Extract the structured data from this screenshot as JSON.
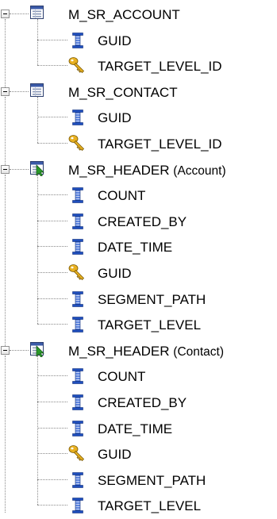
{
  "tree": {
    "nodes": [
      {
        "label": "M_SR_ACCOUNT",
        "suffix": "",
        "icon": "table-icon",
        "expanded": true,
        "children": [
          {
            "label": "GUID",
            "icon": "column-icon"
          },
          {
            "label": "TARGET_LEVEL_ID",
            "icon": "key-icon"
          }
        ]
      },
      {
        "label": "M_SR_CONTACT",
        "suffix": "",
        "icon": "table-icon",
        "expanded": true,
        "children": [
          {
            "label": "GUID",
            "icon": "column-icon"
          },
          {
            "label": "TARGET_LEVEL_ID",
            "icon": "key-icon"
          }
        ]
      },
      {
        "label": "M_SR_HEADER",
        "suffix": "(Account)",
        "icon": "view-icon",
        "expanded": true,
        "children": [
          {
            "label": "COUNT",
            "icon": "column-icon"
          },
          {
            "label": "CREATED_BY",
            "icon": "column-icon"
          },
          {
            "label": "DATE_TIME",
            "icon": "column-icon"
          },
          {
            "label": "GUID",
            "icon": "key-icon"
          },
          {
            "label": "SEGMENT_PATH",
            "icon": "column-icon"
          },
          {
            "label": "TARGET_LEVEL",
            "icon": "column-icon"
          }
        ]
      },
      {
        "label": "M_SR_HEADER",
        "suffix": "(Contact)",
        "icon": "view-icon",
        "expanded": true,
        "children": [
          {
            "label": "COUNT",
            "icon": "column-icon"
          },
          {
            "label": "CREATED_BY",
            "icon": "column-icon"
          },
          {
            "label": "DATE_TIME",
            "icon": "column-icon"
          },
          {
            "label": "GUID",
            "icon": "key-icon"
          },
          {
            "label": "SEGMENT_PATH",
            "icon": "column-icon"
          },
          {
            "label": "TARGET_LEVEL",
            "icon": "column-icon"
          }
        ]
      }
    ]
  },
  "colors": {
    "line": "#8a8a8a",
    "table_icon_blue": "#3b5aa8",
    "column_icon_blue": "#1f4fbf",
    "key_icon_yellow": "#e8b020",
    "view_icon_green": "#2a9a2a"
  }
}
